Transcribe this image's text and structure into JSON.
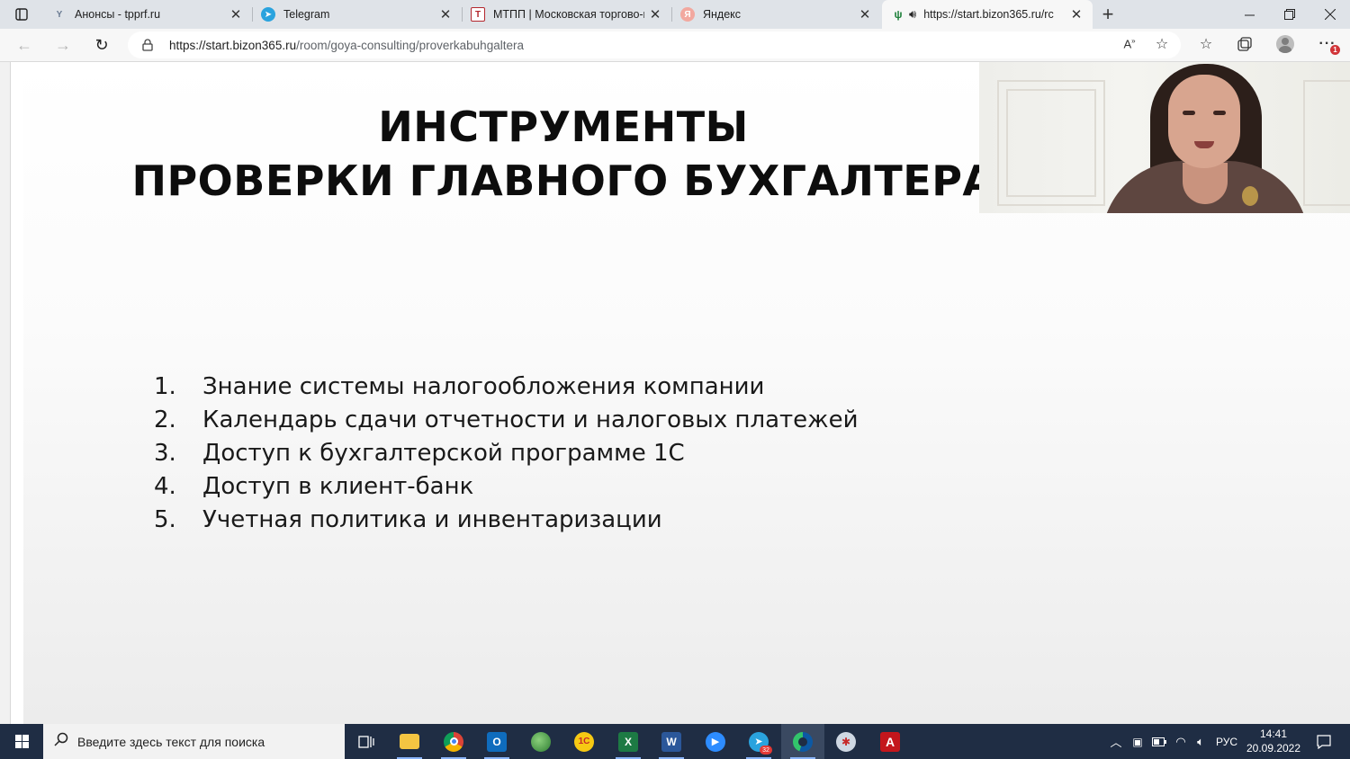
{
  "browser": {
    "tabs": [
      {
        "title": "Анонсы - tpprf.ru",
        "favicon": "tpprf-icon",
        "favicon_color": "#6b7c93",
        "active": false
      },
      {
        "title": "Telegram",
        "favicon": "telegram-icon",
        "favicon_color": "#2aa3de",
        "active": false
      },
      {
        "title": "МТПП | Московская торгово-пр",
        "favicon": "mtpp-icon",
        "favicon_color": "#b3262d",
        "active": false
      },
      {
        "title": "Яндекс",
        "favicon": "yandex-icon",
        "favicon_color": "#f2a89f",
        "active": false
      },
      {
        "title": "https://start.bizon365.ru/rc",
        "favicon": "bizon-icon",
        "favicon_color": "#1d7f3a",
        "active": true,
        "audio": true
      }
    ],
    "address": {
      "url_host": "https://start.bizon365.ru",
      "url_path": "/room/goya-consulting/proverkabuhgaltera"
    },
    "notification_count": "1"
  },
  "slide": {
    "title_line1": "ИНСТРУМЕНТЫ",
    "title_line2": "ПРОВЕРКИ ГЛАВНОГО БУХГАЛТЕРА",
    "items": [
      {
        "num": "1.",
        "text": "Знание системы налогообложения компании"
      },
      {
        "num": "2.",
        "text": "Календарь сдачи отчетности и налоговых платежей"
      },
      {
        "num": "3.",
        "text": "Доступ к бухгалтерской программе 1С"
      },
      {
        "num": "4.",
        "text": "Доступ в клиент-банк"
      },
      {
        "num": "5.",
        "text": "Учетная политика и инвентаризации"
      }
    ]
  },
  "taskbar": {
    "search_placeholder": "Введите здесь текст для поиска",
    "telegram_badge": "32",
    "language": "РУС",
    "time": "14:41",
    "date": "20.09.2022"
  },
  "colors": {
    "taskbar": "#1f2d44",
    "tabstrip": "#dfe3e8",
    "toolbar": "#f7f7f7"
  }
}
